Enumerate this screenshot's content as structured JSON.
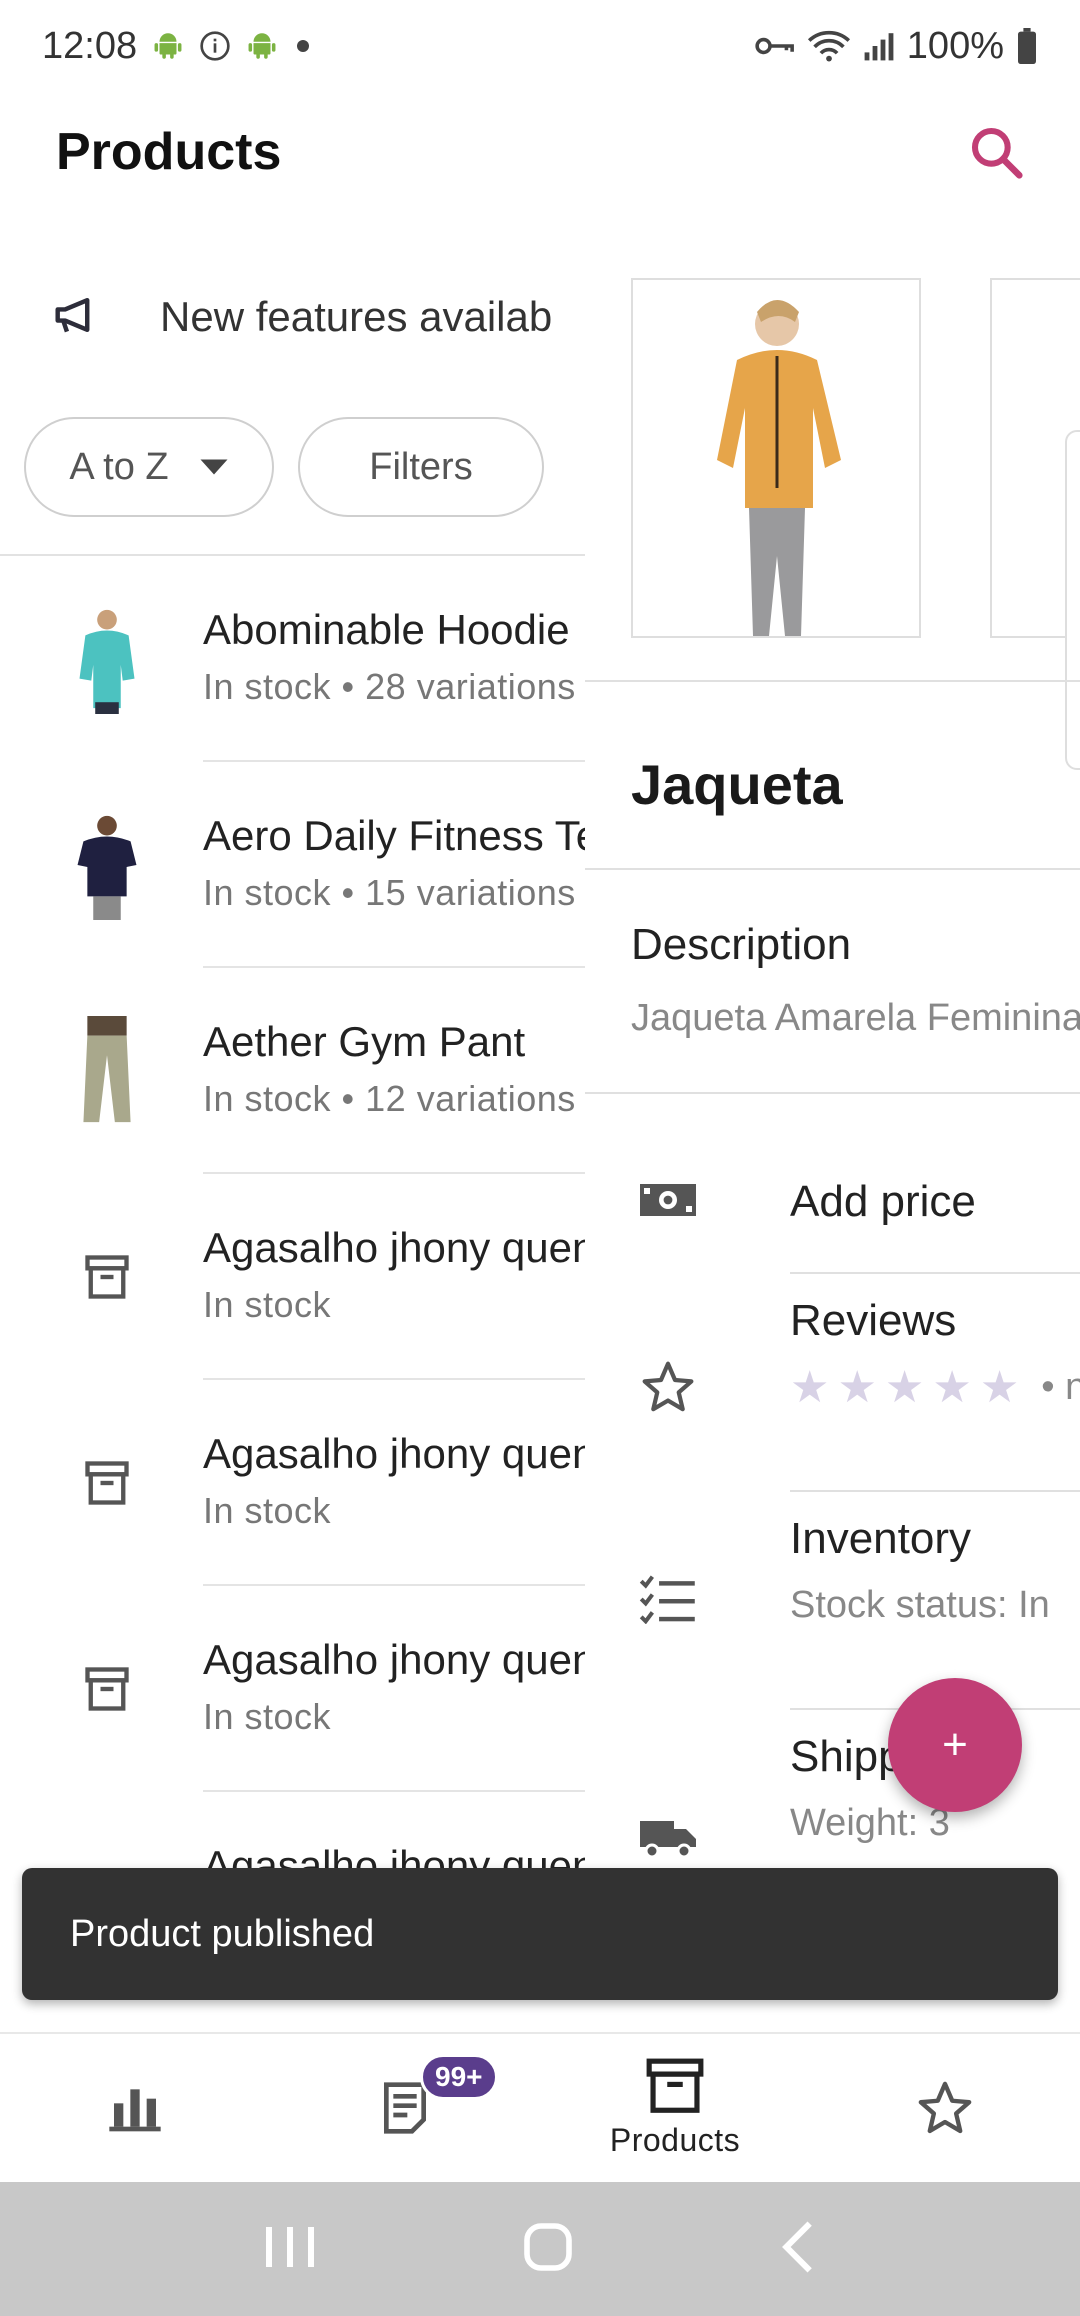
{
  "status_bar": {
    "time": "12:08",
    "battery": "100%"
  },
  "app_bar": {
    "title": "Products"
  },
  "banner": {
    "text": "New features availab"
  },
  "filters": {
    "sort_label": "A to Z",
    "filter_label": "Filters"
  },
  "products": [
    {
      "name": "Abominable Hoodie",
      "meta": "In stock • 28 variations"
    },
    {
      "name": "Aero Daily Fitness Tee",
      "meta": "In stock • 15 variations"
    },
    {
      "name": "Aether Gym Pant",
      "meta": "In stock • 12 variations"
    },
    {
      "name": "Agasalho jhony quente",
      "meta": "In stock"
    },
    {
      "name": "Agasalho jhony quente",
      "meta": "In stock"
    },
    {
      "name": "Agasalho jhony quente",
      "meta": "In stock"
    },
    {
      "name": "Agasalho jhony quente",
      "meta": ""
    }
  ],
  "detail": {
    "title": "Jaqueta",
    "description_label": "Description",
    "description_value": "Jaqueta Amarela Feminina",
    "price_label": "Add price",
    "reviews_label": "Reviews",
    "reviews_suffix": "• n",
    "inventory_label": "Inventory",
    "inventory_value": "Stock status: In",
    "shipping_label": "Shipping",
    "shipping_value": "Weight: 3"
  },
  "fab": {
    "label": "+"
  },
  "snackbar": {
    "text": "Product published"
  },
  "bottom_nav": {
    "items": [
      {
        "icon": "chart-icon",
        "label": ""
      },
      {
        "icon": "orders-icon",
        "label": "",
        "badge": "99+"
      },
      {
        "icon": "products-icon",
        "label": "Products"
      },
      {
        "icon": "star-icon",
        "label": ""
      }
    ]
  },
  "colors": {
    "accent": "#c13e75",
    "badge": "#5a3d8c",
    "snackbar": "#323232"
  }
}
